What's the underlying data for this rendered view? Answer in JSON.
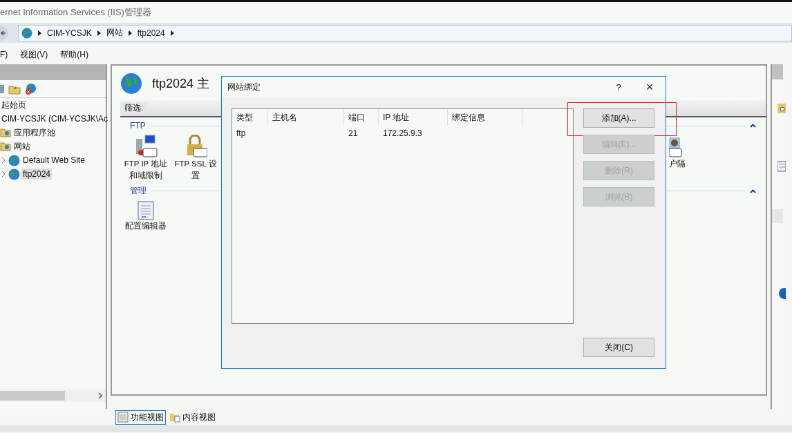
{
  "window": {
    "title": "ernet Information Services (IIS)管理器"
  },
  "address_bar": {
    "crumbs": [
      "CIM-YCSJK",
      "网站",
      "ftp2024"
    ]
  },
  "menu": [
    "F)",
    "视图(V)",
    "帮助(H)"
  ],
  "tree": [
    {
      "label": "起始页",
      "selected": false
    },
    {
      "label": "CIM-YCSJK (CIM-YCSJK\\Ac",
      "selected": false,
      "children": [
        {
          "label": "应用程序池",
          "selected": false
        },
        {
          "label": "网站",
          "selected": false,
          "children": [
            {
              "label": "Default Web Site",
              "selected": false
            },
            {
              "label": "ftp2024",
              "selected": true
            }
          ]
        }
      ]
    }
  ],
  "content": {
    "title": "ftp2024 主",
    "filter_label": "筛选:",
    "groups": [
      {
        "title": "FTP",
        "features": [
          {
            "kind": "ip",
            "label_lines": [
              "FTP IP 地址",
              "和域限制"
            ]
          },
          {
            "kind": "ssl",
            "label_lines": [
              "FTP SSL 设",
              "置"
            ]
          },
          {
            "kind": "user",
            "label_lines": [
              "户隔"
            ]
          }
        ]
      },
      {
        "title": "管理",
        "features": [
          {
            "kind": "config",
            "label_lines": [
              "配置编辑器"
            ]
          }
        ]
      }
    ]
  },
  "view_tabs": [
    {
      "label": "功能视图",
      "selected": true
    },
    {
      "label": "内容视图",
      "selected": false
    }
  ],
  "dialog": {
    "title": "网站绑定",
    "help": "?",
    "close": "×",
    "columns": [
      "类型",
      "主机名",
      "端口",
      "IP 地址",
      "绑定信息"
    ],
    "rows": [
      {
        "selected": false,
        "cells": [
          "ftp",
          "",
          "21",
          "172.25.9.3",
          ""
        ]
      }
    ],
    "buttons": [
      {
        "label": "添加(A)...",
        "disabled": false,
        "highlighted": true
      },
      {
        "label": "编辑(E)...",
        "disabled": true,
        "highlighted": false
      },
      {
        "label": "删除(R)",
        "disabled": true,
        "highlighted": false
      },
      {
        "label": "浏览(B)",
        "disabled": true,
        "highlighted": false
      }
    ],
    "close_button": "关闭(C)"
  }
}
